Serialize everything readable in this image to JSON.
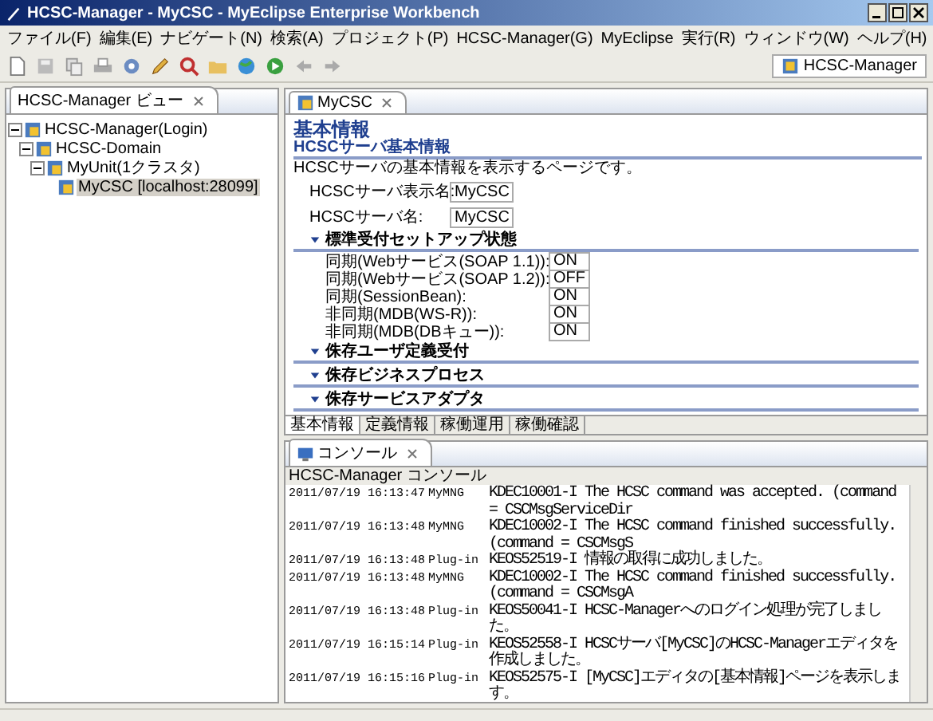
{
  "window": {
    "title": "HCSC-Manager - MyCSC - MyEclipse Enterprise Workbench"
  },
  "menu": [
    "ファイル(F)",
    "編集(E)",
    "ナビゲート(N)",
    "検索(A)",
    "プロジェクト(P)",
    "HCSC-Manager(G)",
    "MyEclipse",
    "実行(R)",
    "ウィンドウ(W)",
    "ヘルプ(H)"
  ],
  "perspective": {
    "label": "HCSC-Manager"
  },
  "tree_view": {
    "title": "HCSC-Manager ビュー",
    "items": [
      {
        "label": "HCSC-Manager(Login)",
        "expanded": true,
        "selected": false,
        "children": [
          {
            "label": "HCSC-Domain",
            "expanded": true,
            "selected": false,
            "children": [
              {
                "label": "MyUnit(1クラスタ)",
                "expanded": true,
                "selected": false,
                "children": [
                  {
                    "label": "MyCSC [localhost:28099]",
                    "selected": true
                  }
                ]
              }
            ]
          }
        ]
      }
    ]
  },
  "editor": {
    "tab": "MyCSC",
    "title": "基本情報",
    "section": "HCSCサーバ基本情報",
    "description": "HCSCサーバの基本情報を表示するページです。",
    "fields": [
      {
        "label": "HCSCサーバ表示名:",
        "value": "MyCSC"
      },
      {
        "label": "HCSCサーバ名:",
        "value": "MyCSC"
      }
    ],
    "groups": [
      {
        "title": "標準受付セットアップ状態",
        "expanded": true,
        "rows": [
          {
            "label": "同期(Webサービス(SOAP 1.1)):",
            "value": "ON"
          },
          {
            "label": "同期(Webサービス(SOAP 1.2)):",
            "value": "OFF"
          },
          {
            "label": "同期(SessionBean):",
            "value": "ON"
          },
          {
            "label": "非同期(MDB(WS-R)):",
            "value": "ON"
          },
          {
            "label": "非同期(MDB(DBキュー)):",
            "value": "ON"
          }
        ]
      },
      {
        "title": "侏存ユーザ定義受付",
        "expanded": true
      },
      {
        "title": "侏存ビジネスプロセス",
        "expanded": true
      },
      {
        "title": "侏存サービスアダプタ",
        "expanded": true
      }
    ],
    "page_tabs": [
      {
        "label": "基本情報",
        "selected": true
      },
      {
        "label": "定義情報",
        "selected": false
      },
      {
        "label": "稼働運用",
        "selected": false
      },
      {
        "label": "稼働確認",
        "selected": false
      }
    ]
  },
  "console": {
    "tab": "コンソール",
    "label": "HCSC-Manager コンソール",
    "lines": [
      {
        "time": "2011/07/19 16:13:47",
        "source": "MyMNG",
        "message": "KDEC10001-I The HCSC command was accepted. (command = CSCMsgServiceDir"
      },
      {
        "time": "2011/07/19 16:13:48",
        "source": "MyMNG",
        "message": "KDEC10002-I The HCSC command finished successfully. (command = CSCMsgS"
      },
      {
        "time": "2011/07/19 16:13:48",
        "source": "Plug-in",
        "message": "KEOS52519-I 情報の取得に成功しました。"
      },
      {
        "time": "2011/07/19 16:13:48",
        "source": "MyMNG",
        "message": "KDEC10002-I The HCSC command finished successfully. (command = CSCMsgA"
      },
      {
        "time": "2011/07/19 16:13:48",
        "source": "Plug-in",
        "message": "KEOS50041-I HCSC-Managerへのログイン処理が完了しました。"
      },
      {
        "time": "2011/07/19 16:15:14",
        "source": "Plug-in",
        "message": "KEOS52558-I HCSCサーバ[MyCSC]のHCSC-Managerエディタを作成しました。"
      },
      {
        "time": "2011/07/19 16:15:16",
        "source": "Plug-in",
        "message": "KEOS52575-I [MyCSC]エディタの[基本情報]ページを表示します。"
      }
    ]
  }
}
